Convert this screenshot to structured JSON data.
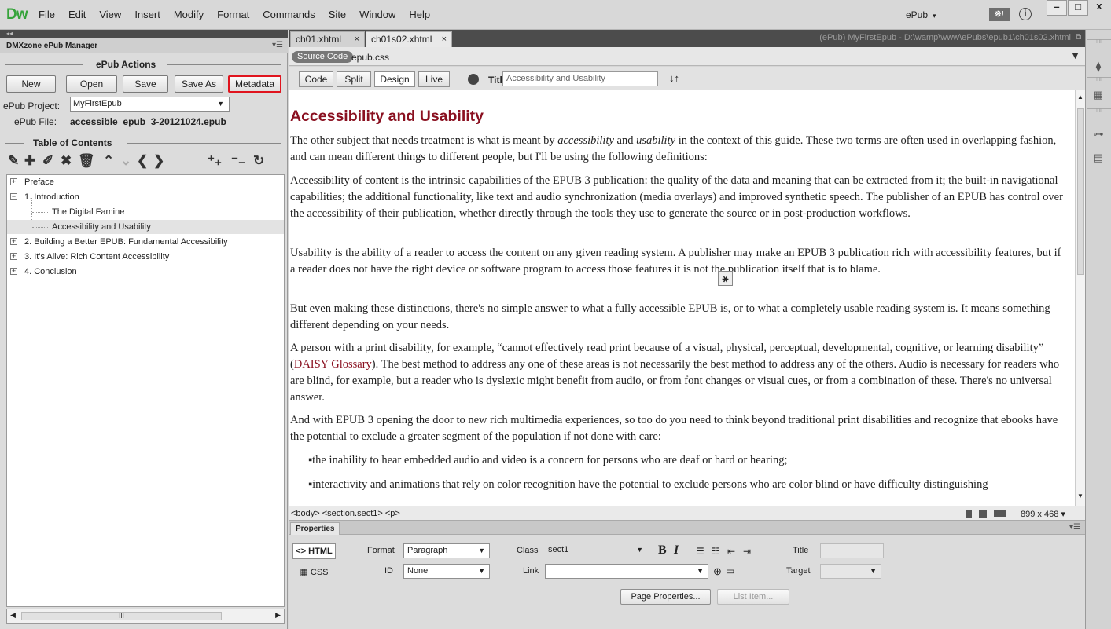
{
  "app": {
    "logo": "Dw",
    "workspace": "ePub",
    "grid_label": "※!",
    "info": "i"
  },
  "menu": [
    "File",
    "Edit",
    "View",
    "Insert",
    "Modify",
    "Format",
    "Commands",
    "Site",
    "Window",
    "Help"
  ],
  "window_controls": {
    "minimize": "–",
    "maximize": "□",
    "close": "x"
  },
  "left_panel": {
    "collapse": "◂◂",
    "title": "DMXzone ePub Manager",
    "actions_heading": "ePub Actions",
    "buttons": {
      "new": "New",
      "open": "Open",
      "save": "Save",
      "save_as": "Save As",
      "metadata": "Metadata"
    },
    "project_label": "ePub Project:",
    "project_value": "MyFirstEpub",
    "file_label": "ePub File:",
    "file_value": "accessible_epub_3-20121024.epub",
    "toc_heading": "Table of Contents",
    "toc": [
      {
        "label": "Preface",
        "exp": "+"
      },
      {
        "label": "1. Introduction",
        "exp": "−"
      },
      {
        "label": "The Digital Famine"
      },
      {
        "label": "Accessibility and Usability"
      },
      {
        "label": "2. Building a Better EPUB: Fundamental Accessibility",
        "exp": "+"
      },
      {
        "label": "3. It's Alive: Rich Content Accessibility",
        "exp": "+"
      },
      {
        "label": "4. Conclusion",
        "exp": "+"
      }
    ],
    "scroll_grip": "III"
  },
  "tabs": {
    "tab1": "ch01.xhtml",
    "tab2": "ch01s02.xhtml",
    "close": "×"
  },
  "file_path": "(ePub) MyFirstEpub - D:\\wamp\\www\\ePubs\\epub1\\ch01s02.xhtml",
  "related_files": {
    "source": "Source Code",
    "css": "epub.css"
  },
  "view_buttons": {
    "code": "Code",
    "split": "Split",
    "design": "Design",
    "live": "Live"
  },
  "doc_title_label": "Title:",
  "doc_title_value": "Accessibility and Usability",
  "content": {
    "heading": "Accessibility and Usability",
    "p1_a": "The other subject that needs treatment is what is meant by ",
    "p1_em1": "accessibility",
    "p1_b": " and ",
    "p1_em2": "usability",
    "p1_c": " in the context of this guide. These two terms are often used in overlapping fashion, and can mean different things to different people, but I'll be using the following definitions:",
    "p2": "Accessibility of content is the intrinsic capabilities of the EPUB 3 publication: the quality of the data and meaning that can be extracted from it; the built-in navigational capabilities; the additional functionality, like text and audio synchronization (media overlays) and improved synthetic speech. The publisher of an EPUB has control over the accessibility of their publication, whether directly through the tools they use to generate the source or in post-production workflows.",
    "p3": "Usability is the ability of a reader to access the content on any given reading system. A publisher may make an EPUB 3 publication rich with accessibility features, but if a reader does not have the right device or software program to access those features it is not the publication itself that is to blame.",
    "p4": "But even making these distinctions, there's no simple answer to what a fully accessible EPUB is, or to what a completely usable reading system is. It means something different depending on your needs.",
    "p5_a": "A person with a print disability, for example, “cannot effectively read print because of a visual, physical, perceptual, developmental, cognitive, or learning disability” (",
    "p5_link": "DAISY Glossary",
    "p5_b": "). The best method to address any one of these areas is not necessarily the best method to address any of the others. Audio is necessary for readers who are blind, for example, but a reader who is dyslexic might benefit from audio, or from font changes or visual cues, or from a combination of these. There's no universal answer.",
    "p6": "And with EPUB 3 opening the door to new rich multimedia experiences, so too do you need to think beyond traditional print disabilities and recognize that ebooks have the potential to exclude a greater segment of the population if not done with care:",
    "b1": "the inability to hear embedded audio and video is a concern for persons who are deaf or hard or hearing;",
    "b2": "interactivity and animations that rely on color recognition have the potential to exclude persons who are color blind or have difficulty distinguishing",
    "anchor_glyph": "⚹"
  },
  "tag_selector": "<body> <section.sect1> <p>",
  "window_size": "899 x 468",
  "properties": {
    "tab": "Properties",
    "html_btn": "<> HTML",
    "css_btn": "CSS",
    "format_label": "Format",
    "format_value": "Paragraph",
    "id_label": "ID",
    "id_value": "None",
    "class_label": "Class",
    "class_value": "sect1",
    "link_label": "Link",
    "link_value": "",
    "bold": "B",
    "italic": "I",
    "title_label": "Title",
    "target_label": "Target",
    "page_properties": "Page Properties...",
    "list_item": "List Item..."
  },
  "colors": {
    "accent_red": "#e0141e",
    "heading": "#8a1020",
    "dw_green": "#35a33a"
  }
}
